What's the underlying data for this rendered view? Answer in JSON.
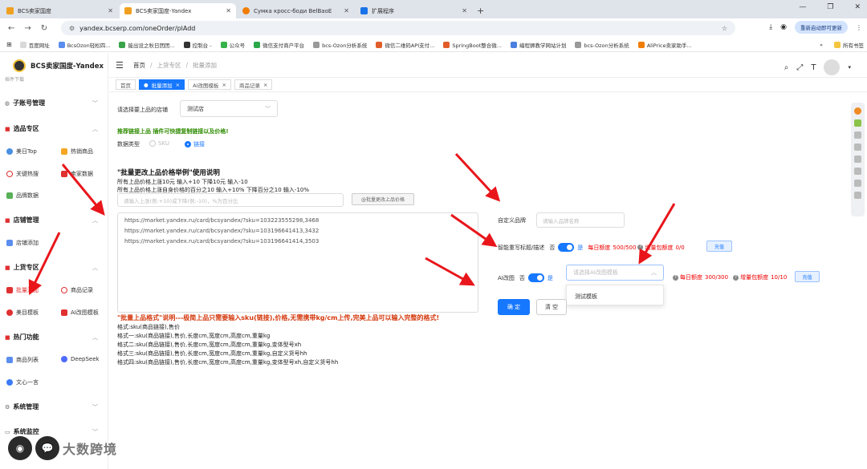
{
  "browser": {
    "tabs": [
      {
        "title": "BCS卖家国度",
        "color": "#f0a020"
      },
      {
        "title": "BCS卖家国度-Yandex",
        "color": "#f0a020"
      },
      {
        "title": "Сумка кросс-боди BelBaoE",
        "color": "#f07d00"
      },
      {
        "title": "扩展程序",
        "color": "#1a73e8"
      }
    ],
    "url": "yandex.bcserp.com/oneOrder/plAdd",
    "restart_label": "重新启动即可更新",
    "bookmarks": [
      "百度网址",
      "BcsOzon轻松四...",
      "能出设之秋日团团...",
      "控制台 -",
      "公众号",
      "微信支付商户平台",
      "bcs-Ozon分析系统",
      "微信二维码API支付...",
      "SpringBoot整合微...",
      "编程狮教学网站计划",
      "bcs-Ozon分析系统",
      "AliPrice卖家助手..."
    ],
    "bookmarks_more": "»",
    "all_bookmarks": "所有书签"
  },
  "sidebar": {
    "logo_text": "BCS卖家国度-Yandex",
    "partial_top": "插件下载",
    "groups": [
      {
        "label": "子账号管理",
        "items": []
      },
      {
        "label": "选品专区",
        "items": [
          "美日Top",
          "热销商品",
          "关键热搜",
          "卖家数据",
          "品牌数据"
        ]
      },
      {
        "label": "店铺管理",
        "items": [
          "店铺添加"
        ]
      },
      {
        "label": "上货专区",
        "items": [
          "批量添加",
          "商品记录",
          "美目模板",
          "AI改图模板"
        ]
      },
      {
        "label": "热门功能",
        "items": [
          "商品列表",
          "DeepSeek",
          "文心一言"
        ]
      },
      {
        "label": "系统管理",
        "items": []
      },
      {
        "label": "系统监控",
        "items": []
      }
    ]
  },
  "topbar": {
    "breadcrumb": [
      "首页",
      "上货专区",
      "批量添加"
    ]
  },
  "tags": [
    "首页",
    "批量添加",
    "AI改图模板",
    "商品记录"
  ],
  "form": {
    "store_label": "请选择要上品的店铺",
    "store_value": "测试店",
    "green_tip": "推荐链接上品 插件可快捷复制链接以及价格!",
    "data_type_label": "数据类型",
    "data_type_options": [
      "SKU",
      "链接"
    ],
    "price_title": "\"批量更改上品价格举例\"使用说明",
    "price_lines": [
      "所有上品价格上涨10元 输入+10 下降10元 输入-10",
      "所有上品价格上涨自身价格的百分之10 输入+10% 下降百分之10 输入-10%"
    ],
    "price_placeholder": "请输入上涨(例:+10)或下降(例:-10)，%为百分比",
    "price_button": "@批量更改上品价格",
    "links": [
      "https://market.yandex.ru/card/bcsyandex/?sku=103223555298,3468",
      "https://market.yandex.ru/card/bcsyandex/?sku=103196641413,3432",
      "https://market.yandex.ru/card/bcsyandex/?sku=103196641414,3503"
    ],
    "format_title": "\"批量上品格式\"说明---极简上品只需要输入sku(链接),价格,无需携带kg/cm上传,完美上品可以输入完整的格式!",
    "format_lines": [
      "格式:sku(商品链接),售价",
      "格式一:sku(商品链接),售价,长度cm,宽度cm,高度cm,重量kg",
      "格式二:sku(商品链接),售价,长度cm,宽度cm,高度cm,重量kg,变体型号xh",
      "格式三:sku(商品链接),售价,长度cm,宽度cm,高度cm,重量kg,自定义货号hh",
      "格式四:sku(商品链接),售价,长度cm,宽度cm,高度cm,重量kg,变体型号xh,自定义货号hh"
    ],
    "brand_label": "自定义品牌",
    "brand_placeholder": "请输入品牌名称",
    "rewrite_label": "智能重写标题/描述",
    "ai_label": "AI改图",
    "no": "否",
    "yes": "是",
    "daily_quota": "每日额度",
    "rewrite_quota": "500/500",
    "pack_quota": "增量包额度",
    "rewrite_pack": "0/0",
    "ai_quota": "300/300",
    "ai_pack": "10/10",
    "recharge": "充值",
    "ai_template_placeholder": "请选择AI改图模板",
    "ai_template_option": "测试模板",
    "confirm": "确 定",
    "clear": "清 空"
  },
  "watermark": "大数跨境"
}
